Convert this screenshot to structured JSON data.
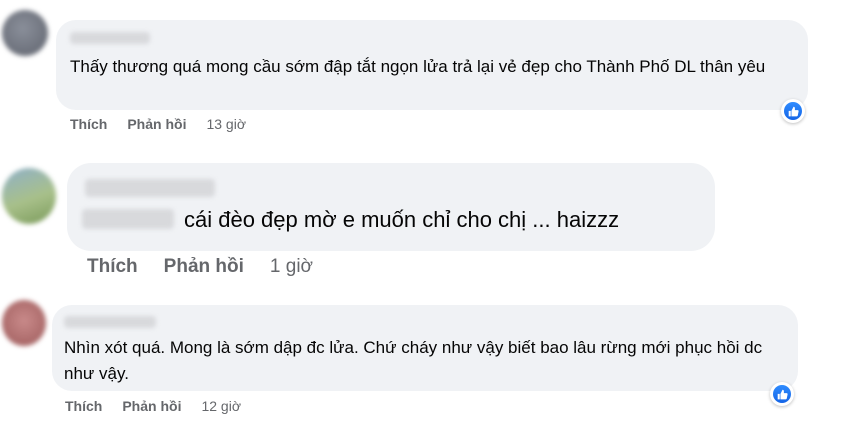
{
  "comments": [
    {
      "text": "Thấy thương quá mong cầu sớm đập tắt ngọn lửa trả lại vẻ đẹp cho Thành Phố DL thân yêu",
      "like_label": "Thích",
      "reply_label": "Phản hồi",
      "time": "13 giờ",
      "reaction": "like-icon"
    },
    {
      "text": "cái đèo đẹp mờ e muốn chỉ cho chị ... haizzz",
      "like_label": "Thích",
      "reply_label": "Phản hồi",
      "time": "1 giờ"
    },
    {
      "text": "Nhìn xót quá. Mong là sớm dập đc lửa. Chứ cháy như vậy biết bao lâu rừng mới phục hồi dc như vậy.",
      "like_label": "Thích",
      "reply_label": "Phản hồi",
      "time": "12 giờ",
      "reaction": "like-icon"
    }
  ],
  "colors": {
    "bubble": "#f0f2f5",
    "action_text": "#65676b",
    "like_blue": "#1877f2"
  }
}
